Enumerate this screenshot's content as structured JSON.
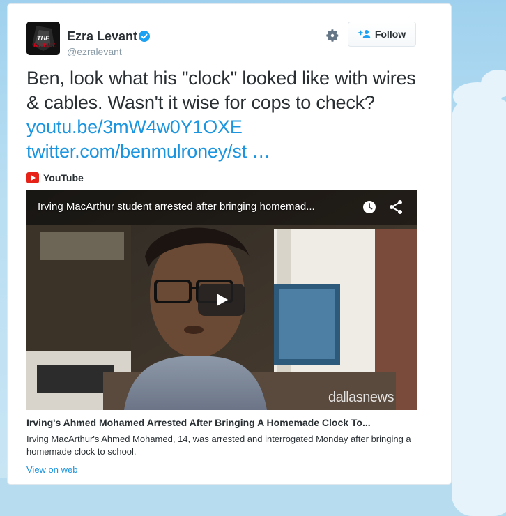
{
  "user": {
    "display_name": "Ezra Levant",
    "handle": "@ezralevant",
    "avatar_text": "THE REBEL",
    "verified": true
  },
  "actions": {
    "follow_label": "Follow"
  },
  "tweet": {
    "text": "Ben, look what his \"clock\" looked like with wires & cables. Wasn't it wise for cops to check? ",
    "link1": "youtu.be/3mW4w0Y1OXE",
    "link2": "twitter.com/benmulroney/st …"
  },
  "media": {
    "source": "YouTube",
    "video_title": "Irving MacArthur student arrested after bringing homemad...",
    "watermark": "dallasnews",
    "card_title": "Irving's Ahmed Mohamed Arrested After Bringing A Homemade Clock To...",
    "card_description": "Irving MacArthur's Ahmed Mohamed, 14, was arrested and interrogated Monday after bringing a homemade clock to school.",
    "view_on_web": "View on web"
  },
  "colors": {
    "link": "#1b95e0",
    "text": "#292f33",
    "muted": "#8899a6",
    "youtube_red": "#e62117"
  },
  "icons": {
    "verified": "verified-badge-icon",
    "gear": "gear-icon",
    "follow": "add-user-icon",
    "youtube": "youtube-icon",
    "clock": "watch-later-icon",
    "share": "share-icon",
    "play": "play-icon"
  }
}
